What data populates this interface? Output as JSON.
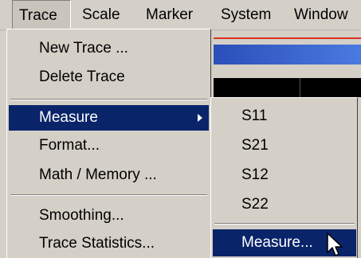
{
  "menubar": {
    "items": [
      {
        "label": "Trace",
        "active": true
      },
      {
        "label": "Scale"
      },
      {
        "label": "Marker"
      },
      {
        "label": "System"
      },
      {
        "label": "Window"
      }
    ]
  },
  "trace_menu": {
    "items": [
      {
        "label": "New Trace ..."
      },
      {
        "label": "Delete Trace"
      },
      {
        "label": "Measure",
        "has_submenu": true,
        "selected": true
      },
      {
        "label": "Format..."
      },
      {
        "label": "Math / Memory ..."
      },
      {
        "label": "Smoothing..."
      },
      {
        "label": "Trace Statistics..."
      }
    ]
  },
  "measure_submenu": {
    "items": [
      {
        "label": "S11"
      },
      {
        "label": "S21"
      },
      {
        "label": "S12"
      },
      {
        "label": "S22"
      },
      {
        "label": "Measure...",
        "selected": true
      }
    ]
  },
  "colors": {
    "menu_bg": "#d4d0c8",
    "selection": "#0a246a",
    "title_bar": "#2a4fb8"
  },
  "cursor_icon": "arrow-pointer-icon"
}
